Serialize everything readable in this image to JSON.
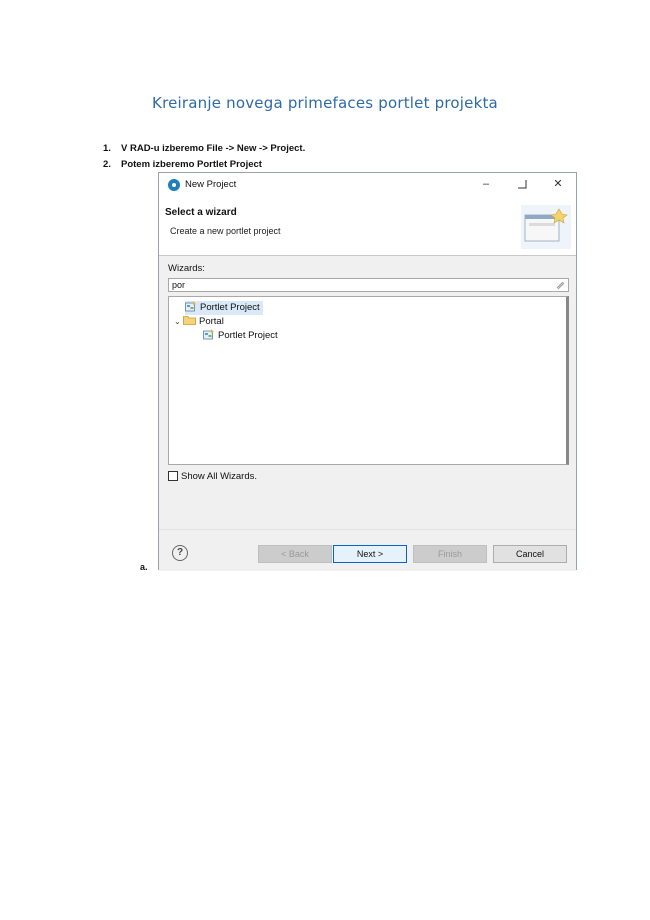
{
  "document": {
    "title": "Kreiranje novega primefaces portlet projekta",
    "steps": [
      {
        "num": "1.",
        "text": "V RAD-u izberemo File -> New -> Project."
      },
      {
        "num": "2.",
        "text": "Potem izberemo Portlet Project"
      }
    ],
    "sub_marker": "a."
  },
  "dialog": {
    "window_title": "New Project",
    "window_controls": {
      "minimize": "–",
      "maximize": "☐",
      "close": "✕"
    },
    "header_title": "Select a wizard",
    "header_description": "Create a new portlet project",
    "wizards_label": "Wizards:",
    "filter_value": "por",
    "tree": [
      {
        "label": "Portlet Project",
        "selected": true,
        "icon": "portlet-project-icon"
      },
      {
        "label": "Portal",
        "expanded": true,
        "icon": "folder-icon"
      },
      {
        "label": "Portlet Project",
        "child": true,
        "icon": "portlet-project-icon"
      }
    ],
    "show_all_label": "Show All Wizards.",
    "show_all_checked": false,
    "buttons": {
      "help": "?",
      "back": "< Back",
      "next": "Next >",
      "finish": "Finish",
      "cancel": "Cancel"
    },
    "colors": {
      "accent": "#0a64c8",
      "selection": "#d9e9f8",
      "title": "#2f6aa8"
    }
  }
}
